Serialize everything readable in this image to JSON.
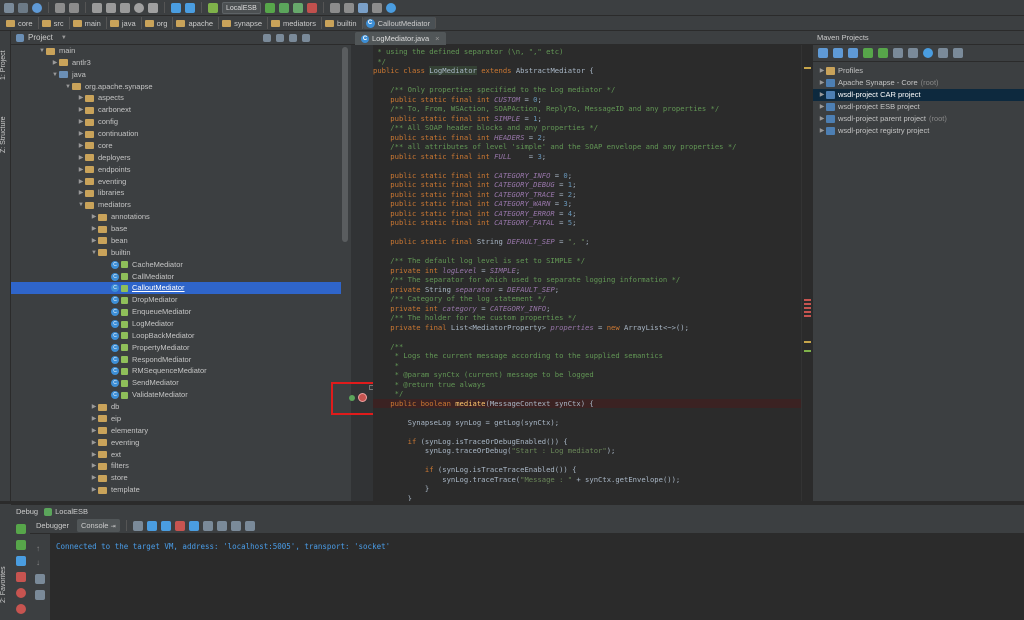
{
  "toolbar": {
    "run_config": "LocalESB"
  },
  "breadcrumbs": [
    "core",
    "src",
    "main",
    "java",
    "org",
    "apache",
    "synapse",
    "mediators",
    "builtin",
    "CalloutMediator"
  ],
  "left_tabs": {
    "project": "1: Project",
    "structure": "Z: Structure",
    "favorites": "2: Favorites"
  },
  "project_panel": {
    "title": "Project"
  },
  "project_tree": [
    {
      "label": "main",
      "type": "folder",
      "depth": 2,
      "expanded": true
    },
    {
      "label": "antlr3",
      "type": "folder",
      "depth": 3,
      "expanded": false
    },
    {
      "label": "java",
      "type": "src",
      "depth": 3,
      "expanded": true
    },
    {
      "label": "org.apache.synapse",
      "type": "package",
      "depth": 4,
      "expanded": true
    },
    {
      "label": "aspects",
      "type": "package",
      "depth": 5,
      "expanded": false
    },
    {
      "label": "carbonext",
      "type": "package",
      "depth": 5,
      "expanded": false
    },
    {
      "label": "config",
      "type": "package",
      "depth": 5,
      "expanded": false
    },
    {
      "label": "continuation",
      "type": "package",
      "depth": 5,
      "expanded": false
    },
    {
      "label": "core",
      "type": "package",
      "depth": 5,
      "expanded": false
    },
    {
      "label": "deployers",
      "type": "package",
      "depth": 5,
      "expanded": false
    },
    {
      "label": "endpoints",
      "type": "package",
      "depth": 5,
      "expanded": false
    },
    {
      "label": "eventing",
      "type": "package",
      "depth": 5,
      "expanded": false
    },
    {
      "label": "libraries",
      "type": "package",
      "depth": 5,
      "expanded": false
    },
    {
      "label": "mediators",
      "type": "package",
      "depth": 5,
      "expanded": true
    },
    {
      "label": "annotations",
      "type": "package",
      "depth": 6,
      "expanded": false
    },
    {
      "label": "base",
      "type": "package",
      "depth": 6,
      "expanded": false
    },
    {
      "label": "bean",
      "type": "package",
      "depth": 6,
      "expanded": false
    },
    {
      "label": "builtin",
      "type": "package",
      "depth": 6,
      "expanded": true
    },
    {
      "label": "CacheMediator",
      "type": "class",
      "depth": 7
    },
    {
      "label": "CallMediator",
      "type": "class",
      "depth": 7
    },
    {
      "label": "CalloutMediator",
      "type": "class",
      "depth": 7,
      "selected": true
    },
    {
      "label": "DropMediator",
      "type": "class",
      "depth": 7
    },
    {
      "label": "EnqueueMediator",
      "type": "class",
      "depth": 7
    },
    {
      "label": "LogMediator",
      "type": "class",
      "depth": 7
    },
    {
      "label": "LoopBackMediator",
      "type": "class",
      "depth": 7
    },
    {
      "label": "PropertyMediator",
      "type": "class",
      "depth": 7
    },
    {
      "label": "RespondMediator",
      "type": "class",
      "depth": 7
    },
    {
      "label": "RMSequenceMediator",
      "type": "class",
      "depth": 7
    },
    {
      "label": "SendMediator",
      "type": "class",
      "depth": 7
    },
    {
      "label": "ValidateMediator",
      "type": "class",
      "depth": 7
    },
    {
      "label": "db",
      "type": "package",
      "depth": 6,
      "expanded": false
    },
    {
      "label": "eip",
      "type": "package",
      "depth": 6,
      "expanded": false
    },
    {
      "label": "elementary",
      "type": "package",
      "depth": 6,
      "expanded": false
    },
    {
      "label": "eventing",
      "type": "package",
      "depth": 6,
      "expanded": false
    },
    {
      "label": "ext",
      "type": "package",
      "depth": 6,
      "expanded": false
    },
    {
      "label": "filters",
      "type": "package",
      "depth": 6,
      "expanded": false
    },
    {
      "label": "store",
      "type": "package",
      "depth": 6,
      "expanded": false
    },
    {
      "label": "template",
      "type": "package",
      "depth": 6,
      "expanded": false
    }
  ],
  "editor": {
    "tab": "LogMediator.java",
    "lines": [
      [
        [
          "cm",
          " * using the defined separator (\\n, \",\" etc)"
        ]
      ],
      [
        [
          "cm",
          " */"
        ]
      ],
      [
        [
          "k",
          "public class "
        ],
        [
          "hl",
          "LogMediator"
        ],
        [
          "k",
          " extends "
        ],
        [
          "",
          "AbstractMediator {"
        ]
      ],
      [
        [
          "",
          ""
        ]
      ],
      [
        [
          "cm",
          "    /** Only properties specified to the Log mediator */"
        ]
      ],
      [
        [
          "k",
          "    public static final int "
        ],
        [
          "fd",
          "CUSTOM"
        ],
        [
          "",
          " = "
        ],
        [
          "n",
          "0"
        ],
        [
          "",
          ";"
        ]
      ],
      [
        [
          "cm",
          "    /** To, From, WSAction, SOAPAction, ReplyTo, MessageID and any properties */"
        ]
      ],
      [
        [
          "k",
          "    public static final int "
        ],
        [
          "fd",
          "SIMPLE"
        ],
        [
          "",
          " = "
        ],
        [
          "n",
          "1"
        ],
        [
          "",
          ";"
        ]
      ],
      [
        [
          "cm",
          "    /** All SOAP header blocks and any properties */"
        ]
      ],
      [
        [
          "k",
          "    public static final int "
        ],
        [
          "fd",
          "HEADERS"
        ],
        [
          "",
          " = "
        ],
        [
          "n",
          "2"
        ],
        [
          "",
          ";"
        ]
      ],
      [
        [
          "cm",
          "    /** all attributes of level 'simple' and the SOAP envelope and any properties */"
        ]
      ],
      [
        [
          "k",
          "    public static final int "
        ],
        [
          "fd",
          "FULL"
        ],
        [
          "",
          "    = "
        ],
        [
          "n",
          "3"
        ],
        [
          "",
          ";"
        ]
      ],
      [
        [
          "",
          ""
        ]
      ],
      [
        [
          "k",
          "    public static final int "
        ],
        [
          "fd",
          "CATEGORY_INFO"
        ],
        [
          "",
          " = "
        ],
        [
          "n",
          "0"
        ],
        [
          "",
          ";"
        ]
      ],
      [
        [
          "k",
          "    public static final int "
        ],
        [
          "fd",
          "CATEGORY_DEBUG"
        ],
        [
          "",
          " = "
        ],
        [
          "n",
          "1"
        ],
        [
          "",
          ";"
        ]
      ],
      [
        [
          "k",
          "    public static final int "
        ],
        [
          "fd",
          "CATEGORY_TRACE"
        ],
        [
          "",
          " = "
        ],
        [
          "n",
          "2"
        ],
        [
          "",
          ";"
        ]
      ],
      [
        [
          "k",
          "    public static final int "
        ],
        [
          "fd",
          "CATEGORY_WARN"
        ],
        [
          "",
          " = "
        ],
        [
          "n",
          "3"
        ],
        [
          "",
          ";"
        ]
      ],
      [
        [
          "k",
          "    public static final int "
        ],
        [
          "fd",
          "CATEGORY_ERROR"
        ],
        [
          "",
          " = "
        ],
        [
          "n",
          "4"
        ],
        [
          "",
          ";"
        ]
      ],
      [
        [
          "k",
          "    public static final int "
        ],
        [
          "fd",
          "CATEGORY_FATAL"
        ],
        [
          "",
          " = "
        ],
        [
          "n",
          "5"
        ],
        [
          "",
          ";"
        ]
      ],
      [
        [
          "",
          ""
        ]
      ],
      [
        [
          "k",
          "    public static final "
        ],
        [
          "",
          "String "
        ],
        [
          "fd",
          "DEFAULT_SEP"
        ],
        [
          "",
          " = "
        ],
        [
          "s",
          "\", \""
        ],
        [
          "",
          ";"
        ]
      ],
      [
        [
          "",
          ""
        ]
      ],
      [
        [
          "cm",
          "    /** The default log level is set to SIMPLE */"
        ]
      ],
      [
        [
          "k",
          "    private int "
        ],
        [
          "fd",
          "logLevel"
        ],
        [
          "",
          " = "
        ],
        [
          "fd",
          "SIMPLE"
        ],
        [
          "",
          ";"
        ]
      ],
      [
        [
          "cm",
          "    /** The separator for which used to separate logging information */"
        ]
      ],
      [
        [
          "k",
          "    private "
        ],
        [
          "",
          "String "
        ],
        [
          "fd",
          "separator"
        ],
        [
          "",
          " = "
        ],
        [
          "fd",
          "DEFAULT_SEP"
        ],
        [
          "",
          ";"
        ]
      ],
      [
        [
          "cm",
          "    /** Category of the log statement */"
        ]
      ],
      [
        [
          "k",
          "    private int "
        ],
        [
          "fd",
          "category"
        ],
        [
          "",
          " = "
        ],
        [
          "fd",
          "CATEGORY_INFO"
        ],
        [
          "",
          ";"
        ]
      ],
      [
        [
          "cm",
          "    /** The holder for the custom properties */"
        ]
      ],
      [
        [
          "k",
          "    private final "
        ],
        [
          "",
          "List<MediatorProperty> "
        ],
        [
          "fd",
          "properties"
        ],
        [
          "",
          " = "
        ],
        [
          "k",
          "new "
        ],
        [
          "",
          "ArrayList<~>();"
        ]
      ],
      [
        [
          "",
          ""
        ]
      ],
      [
        [
          "cm",
          "    /**"
        ]
      ],
      [
        [
          "cm",
          "     * Logs the current message according to the supplied semantics"
        ]
      ],
      [
        [
          "cm",
          "     *"
        ]
      ],
      [
        [
          "cm",
          "     * @param synCtx (current) message to be logged"
        ]
      ],
      [
        [
          "cm",
          "     * @return true always"
        ]
      ],
      [
        [
          "cm",
          "     */"
        ]
      ],
      [
        [
          "k",
          "    public boolean "
        ],
        [
          "mt",
          "mediate"
        ],
        [
          "",
          "(MessageContext synCtx) {"
        ]
      ],
      [
        [
          "",
          ""
        ]
      ],
      [
        [
          "",
          "        SynapseLog synLog = getLog(synCtx);"
        ]
      ],
      [
        [
          "",
          ""
        ]
      ],
      [
        [
          "k",
          "        if "
        ],
        [
          "",
          "(synLog.isTraceOrDebugEnabled()) {"
        ]
      ],
      [
        [
          "",
          "            synLog.traceOrDebug("
        ],
        [
          "s",
          "\"Start : Log mediator\""
        ],
        [
          "",
          ");"
        ]
      ],
      [
        [
          "",
          ""
        ]
      ],
      [
        [
          "k",
          "            if "
        ],
        [
          "",
          "(synLog.isTraceTraceEnabled()) {"
        ]
      ],
      [
        [
          "",
          "                synLog.traceTrace("
        ],
        [
          "s",
          "\"Message : \""
        ],
        [
          "",
          " + synCtx.getEnvelope());"
        ]
      ],
      [
        [
          "",
          "            }"
        ]
      ],
      [
        [
          "",
          "        }"
        ]
      ]
    ]
  },
  "maven": {
    "title": "Maven Projects",
    "items": [
      {
        "label": "Profiles",
        "note": "",
        "selected": false,
        "icon": "folder"
      },
      {
        "label": "Apache Synapse - Core",
        "note": "(root)",
        "selected": false,
        "icon": "maven"
      },
      {
        "label": "wsdl-project CAR project",
        "note": "",
        "selected": true,
        "icon": "maven"
      },
      {
        "label": "wsdl-project ESB project",
        "note": "",
        "selected": false,
        "icon": "maven"
      },
      {
        "label": "wsdl-project parent project",
        "note": "(root)",
        "selected": false,
        "icon": "maven"
      },
      {
        "label": "wsdl-project registry project",
        "note": "",
        "selected": false,
        "icon": "maven"
      }
    ]
  },
  "debug": {
    "title": "Debug",
    "config": "LocalESB",
    "tabs": {
      "debugger": "Debugger",
      "console": "Console"
    },
    "console_text": "Connected to the target VM, address: 'localhost:5005', transport: 'socket'"
  },
  "colors": {
    "background": "#2b2b2b",
    "panel": "#3c3f41",
    "selection": "#2f65ca",
    "keyword": "#cc7832",
    "comment": "#629755",
    "field": "#9876aa",
    "highlight_box": "#e01b1b"
  }
}
